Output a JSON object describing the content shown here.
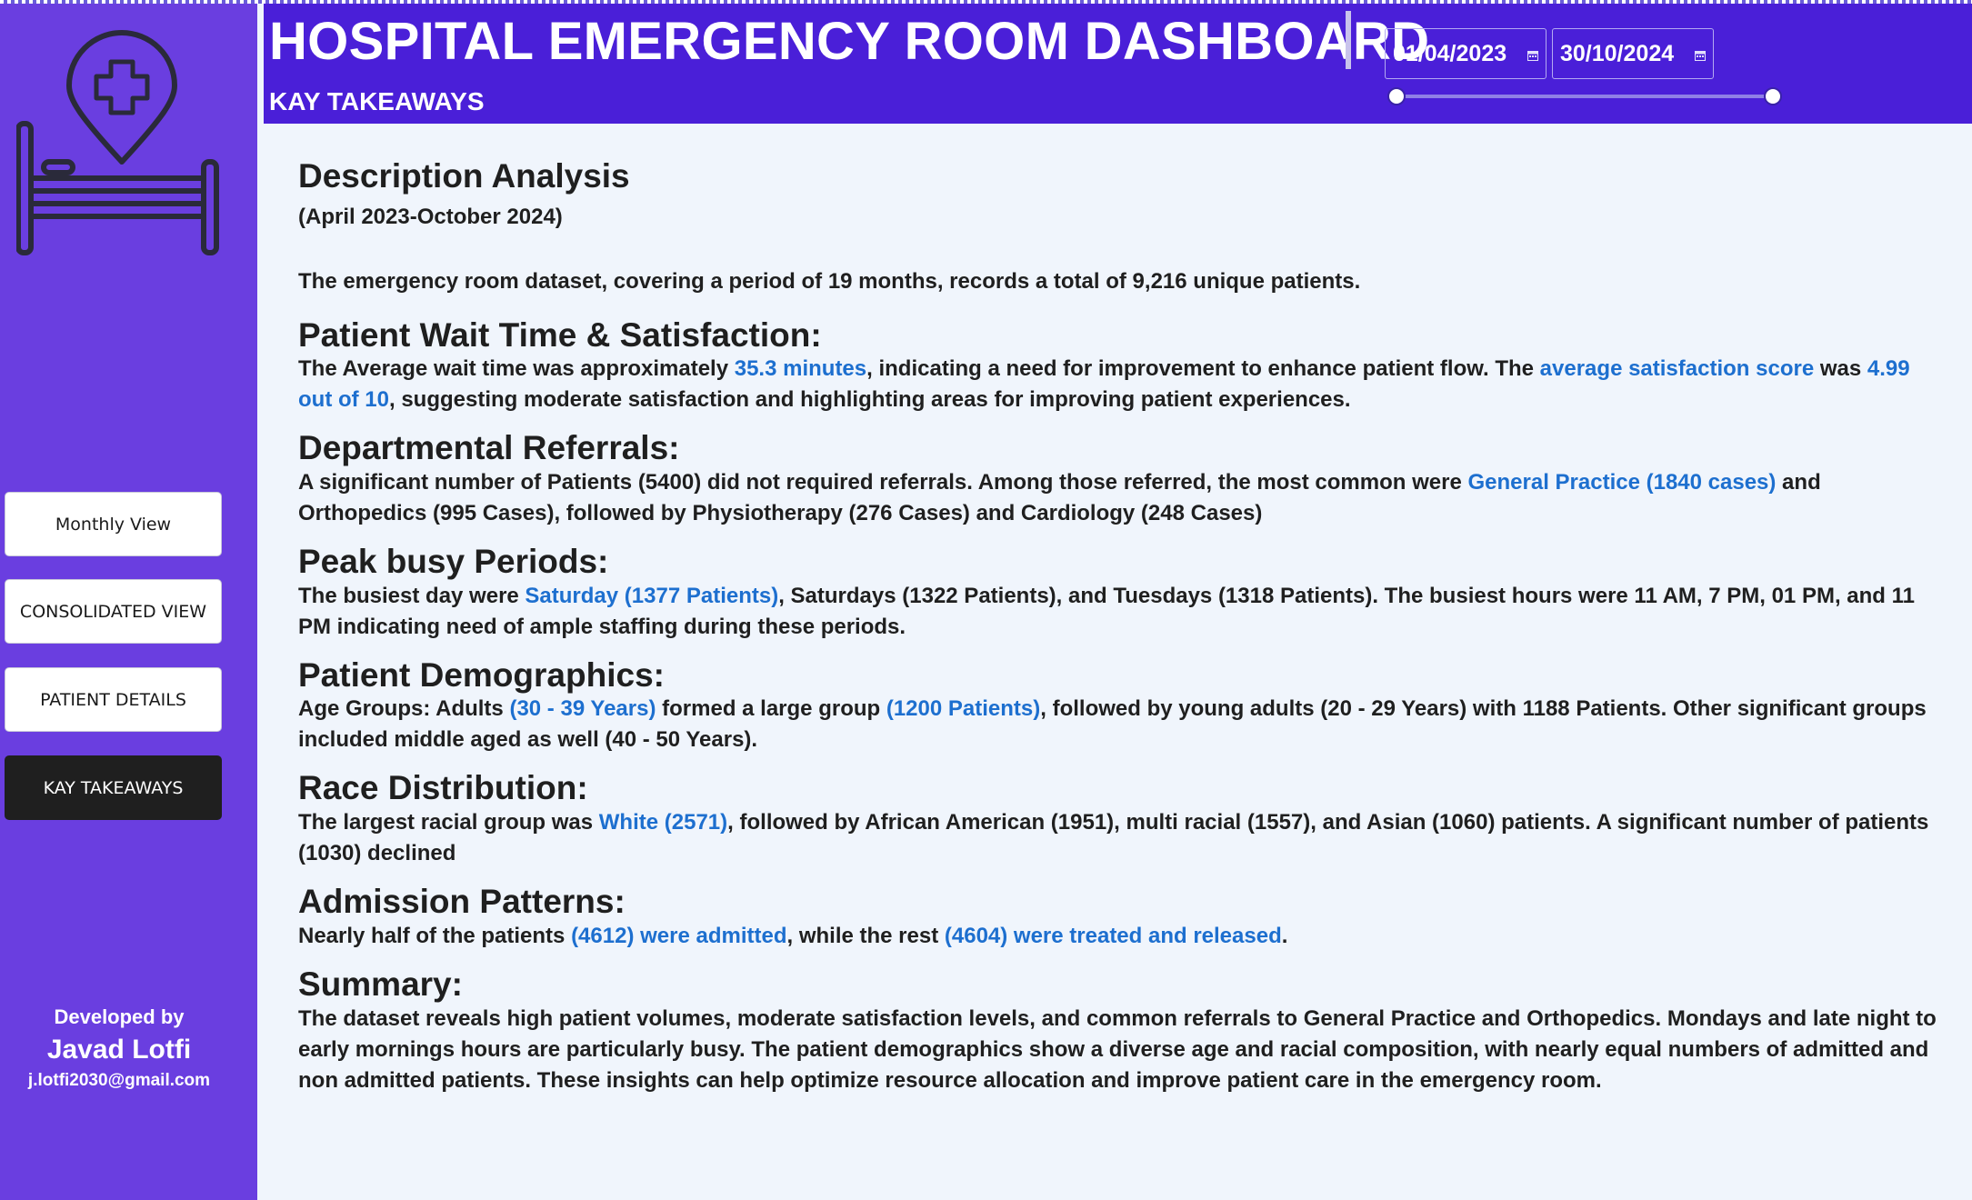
{
  "header": {
    "title": "HOSPITAL EMERGENCY ROOM DASHBOARD",
    "subtitle": "KAY TAKEAWAYS",
    "start_date": "01/04/2023",
    "end_date": "30/10/2024"
  },
  "sidebar": {
    "logo_icon": "hospital-bed-location-pin-icon",
    "nav": [
      {
        "label": "Monthly View",
        "active": false
      },
      {
        "label": "CONSOLIDATED VIEW",
        "active": false
      },
      {
        "label": "PATIENT DETAILS",
        "active": false
      },
      {
        "label": "KAY TAKEAWAYS",
        "active": true
      }
    ],
    "developer_label": "Developed by",
    "developer_name": "Javad Lotfi",
    "developer_email": "j.lotfi2030@gmail.com"
  },
  "colors": {
    "sidebar": "#6a3ee0",
    "header": "#4a1fd8",
    "highlight": "#1d6fcf",
    "background": "#f0f5fc"
  },
  "content": {
    "heading": "Description Analysis",
    "period": "(April 2023-October 2024)",
    "intro": "The emergency room dataset, covering a period of 19 months, records a total of 9,216 unique patients.",
    "sections": [
      {
        "heading": "Patient Wait Time & Satisfaction:",
        "parts": [
          {
            "t": "The Average wait time was approximately "
          },
          {
            "t": "35.3 minutes",
            "hl": true
          },
          {
            "t": ", indicating a need for improvement to enhance patient flow. The "
          },
          {
            "t": "average satisfaction score",
            "hl": true
          },
          {
            "t": " was "
          },
          {
            "t": "4.99 out of 10",
            "hl": true
          },
          {
            "t": ", suggesting moderate satisfaction and highlighting areas for improving patient experiences."
          }
        ]
      },
      {
        "heading": "Departmental Referrals:",
        "parts": [
          {
            "t": "A significant number of Patients (5400) did not required referrals. Among those referred, the most common were "
          },
          {
            "t": "General Practice (1840 cases)",
            "hl": true
          },
          {
            "t": " and Orthopedics (995 Cases), followed by Physiotherapy (276 Cases) and Cardiology (248 Cases)"
          }
        ]
      },
      {
        "heading": "Peak busy Periods:",
        "parts": [
          {
            "t": "The busiest day were "
          },
          {
            "t": "Saturday (1377 Patients)",
            "hl": true
          },
          {
            "t": ", Saturdays (1322 Patients), and Tuesdays (1318 Patients). The busiest hours were 11 AM, 7 PM, 01 PM, and 11 PM indicating need of ample staffing during these periods."
          }
        ]
      },
      {
        "heading": "Patient Demographics:",
        "parts": [
          {
            "t": "Age Groups: Adults "
          },
          {
            "t": "(30 - 39 Years)",
            "hl": true
          },
          {
            "t": " formed a large group "
          },
          {
            "t": "(1200 Patients)",
            "hl": true
          },
          {
            "t": ", followed by young adults (20 - 29 Years) with 1188 Patients. Other significant groups included middle aged as well (40 - 50 Years)."
          }
        ]
      },
      {
        "heading": "Race Distribution:",
        "parts": [
          {
            "t": "The largest racial group was "
          },
          {
            "t": "White (2571)",
            "hl": true
          },
          {
            "t": ", followed by African American (1951), multi racial (1557), and Asian (1060) patients. A significant number of patients (1030) declined"
          }
        ]
      },
      {
        "heading": "Admission Patterns:",
        "parts": [
          {
            "t": "Nearly half of the patients "
          },
          {
            "t": "(4612) were admitted",
            "hl": true
          },
          {
            "t": ", while the rest "
          },
          {
            "t": "(4604) were treated and released",
            "hl": true
          },
          {
            "t": "."
          }
        ]
      },
      {
        "heading": "Summary:",
        "parts": [
          {
            "t": "The dataset reveals high patient volumes, moderate satisfaction levels, and common referrals to General Practice and Orthopedics. Mondays and late night to early mornings hours are particularly busy. The patient demographics show a diverse age and racial composition, with nearly equal numbers of admitted and non admitted patients. These insights can help optimize resource allocation and improve patient care in the emergency room."
          }
        ]
      }
    ]
  }
}
